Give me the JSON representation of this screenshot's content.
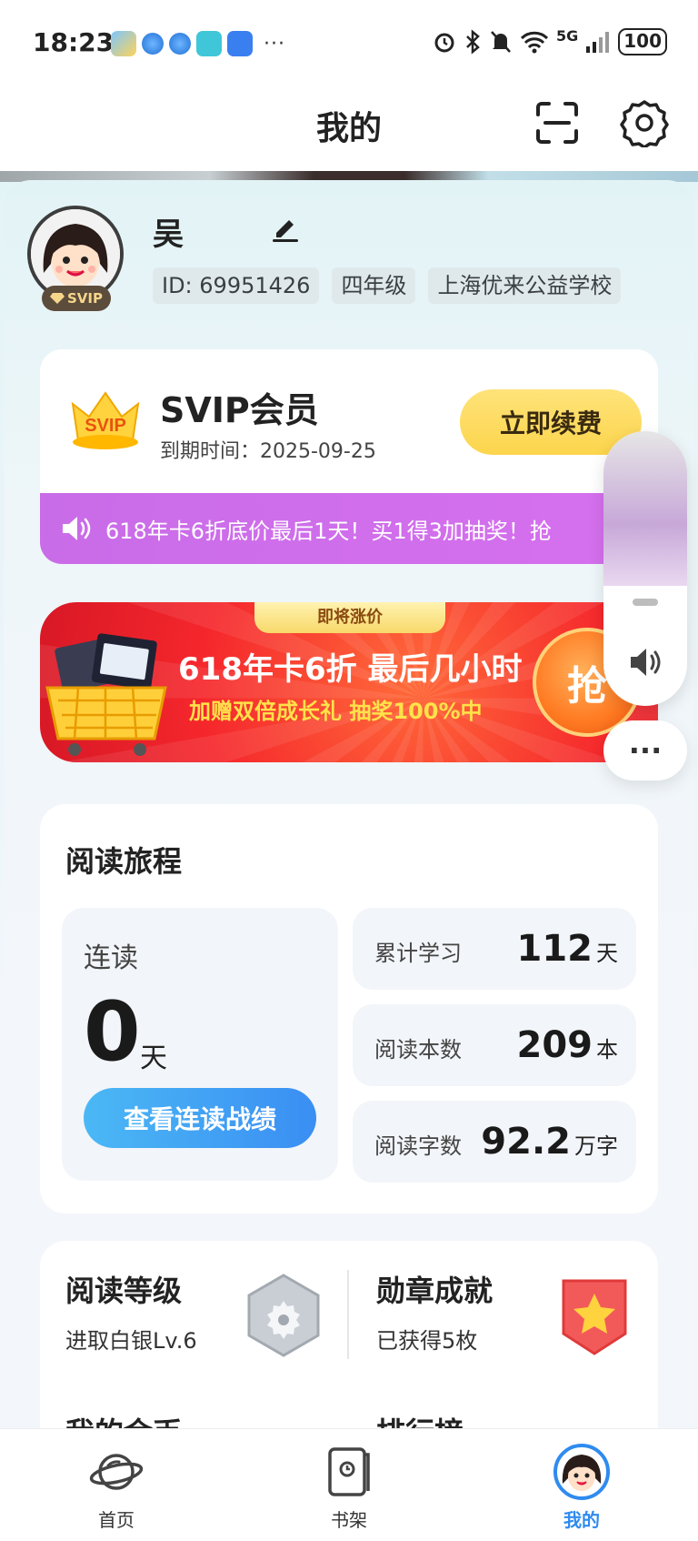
{
  "status_bar": {
    "time": "18:23",
    "dots": "···",
    "network": "5G",
    "battery": "100"
  },
  "header": {
    "title": "我的"
  },
  "profile": {
    "name": "吴",
    "svip_tag": "SVIP",
    "chips": [
      "ID: 69951426",
      "四年级",
      "上海优来公益学校"
    ]
  },
  "svip": {
    "crown_text": "SVIP",
    "title": "SVIP会员",
    "expire": "到期时间：2025-09-25",
    "renew_label": "立即续费",
    "promo_text": "618年卡6折底价最后1天！买1得3加抽奖！抢"
  },
  "banner": {
    "tag": "即将涨价",
    "title": "618年卡6折 最后几小时",
    "subtitle": "加赠双倍成长礼 抽奖100%中",
    "grab_label": "抢"
  },
  "side_control": {
    "more_label": "···"
  },
  "journey": {
    "title": "阅读旅程",
    "streak_label": "连读",
    "streak_value": "0",
    "streak_unit": "天",
    "streak_button": "查看连读战绩",
    "stats": [
      {
        "label": "累计学习",
        "value": "112",
        "unit": "天"
      },
      {
        "label": "阅读本数",
        "value": "209",
        "unit": "本"
      },
      {
        "label": "阅读字数",
        "value": "92.2",
        "unit": "万字"
      }
    ]
  },
  "achievements": {
    "level_title": "阅读等级",
    "level_sub": "进取白银Lv.6",
    "badge_title": "勋章成就",
    "badge_sub": "已获得5枚",
    "row2_left": "我的金币",
    "row2_right": "排行榜"
  },
  "tabs": [
    {
      "label": "首页"
    },
    {
      "label": "书架"
    },
    {
      "label": "我的"
    }
  ],
  "colors": {
    "accent_blue": "#2f8bef",
    "promo_purple": "#d06aea",
    "renew_yellow": "#fcd54c",
    "banner_red": "#f5272c"
  }
}
